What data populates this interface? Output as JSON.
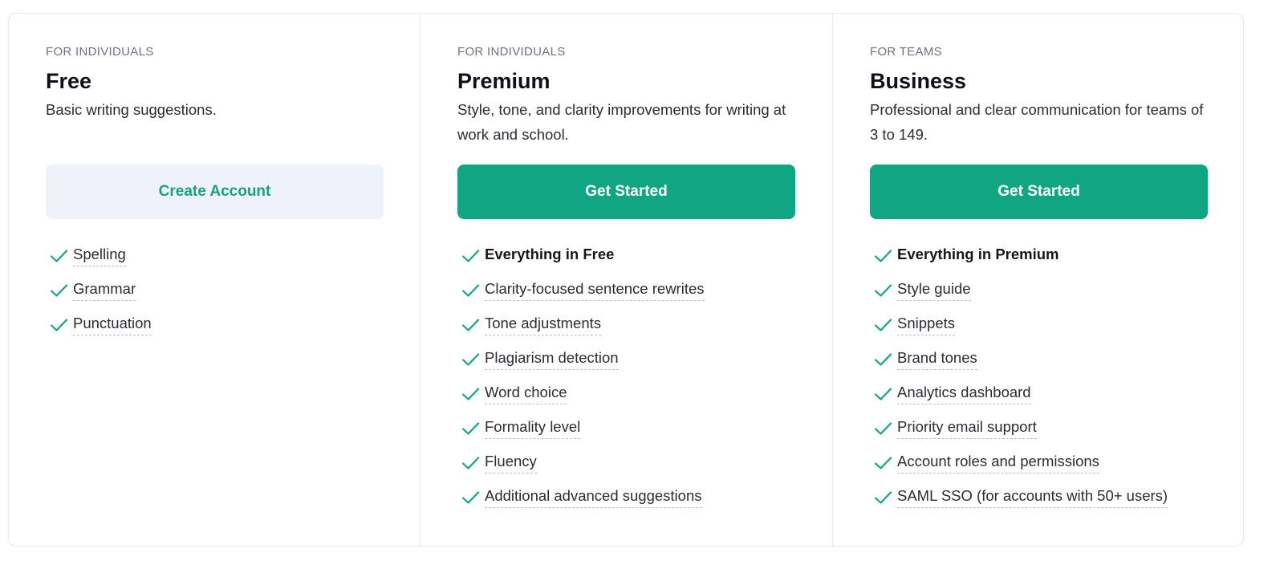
{
  "colors": {
    "accent": "#11a683",
    "accent_text": "#14a37a",
    "secondary_button_bg": "#eff2fa",
    "eyebrow": "#6d7285",
    "divider": "#e6e9f2"
  },
  "plans": [
    {
      "eyebrow": "FOR INDIVIDUALS",
      "name": "Free",
      "description": "Basic writing suggestions.",
      "button": {
        "label": "Create Account",
        "style": "secondary"
      },
      "features": [
        {
          "label": "Spelling",
          "icon": "check-icon",
          "emphasis": false
        },
        {
          "label": "Grammar",
          "icon": "check-icon",
          "emphasis": false
        },
        {
          "label": "Punctuation",
          "icon": "check-icon",
          "emphasis": false
        }
      ]
    },
    {
      "eyebrow": "FOR INDIVIDUALS",
      "name": "Premium",
      "description": "Style, tone, and clarity improvements for writing at work and school.",
      "button": {
        "label": "Get Started",
        "style": "primary"
      },
      "features": [
        {
          "label": "Everything in Free",
          "icon": "check-icon",
          "emphasis": true
        },
        {
          "label": "Clarity-focused sentence rewrites",
          "icon": "check-icon",
          "emphasis": false
        },
        {
          "label": "Tone adjustments",
          "icon": "check-icon",
          "emphasis": false
        },
        {
          "label": "Plagiarism detection",
          "icon": "check-icon",
          "emphasis": false
        },
        {
          "label": "Word choice",
          "icon": "check-icon",
          "emphasis": false
        },
        {
          "label": "Formality level",
          "icon": "check-icon",
          "emphasis": false
        },
        {
          "label": "Fluency",
          "icon": "check-icon",
          "emphasis": false
        },
        {
          "label": "Additional advanced suggestions",
          "icon": "check-icon",
          "emphasis": false
        }
      ]
    },
    {
      "eyebrow": "FOR TEAMS",
      "name": "Business",
      "description": "Professional and clear communication for teams of 3 to 149.",
      "button": {
        "label": "Get Started",
        "style": "primary"
      },
      "features": [
        {
          "label": "Everything in Premium",
          "icon": "check-icon",
          "emphasis": true
        },
        {
          "label": "Style guide",
          "icon": "check-icon",
          "emphasis": false
        },
        {
          "label": "Snippets",
          "icon": "check-icon",
          "emphasis": false
        },
        {
          "label": "Brand tones",
          "icon": "check-icon",
          "emphasis": false
        },
        {
          "label": "Analytics dashboard",
          "icon": "check-icon",
          "emphasis": false
        },
        {
          "label": "Priority email support",
          "icon": "check-icon",
          "emphasis": false
        },
        {
          "label": "Account roles and permissions",
          "icon": "check-icon",
          "emphasis": false
        },
        {
          "label": "SAML SSO (for accounts with 50+ users)",
          "icon": "check-icon",
          "emphasis": false
        }
      ]
    }
  ]
}
